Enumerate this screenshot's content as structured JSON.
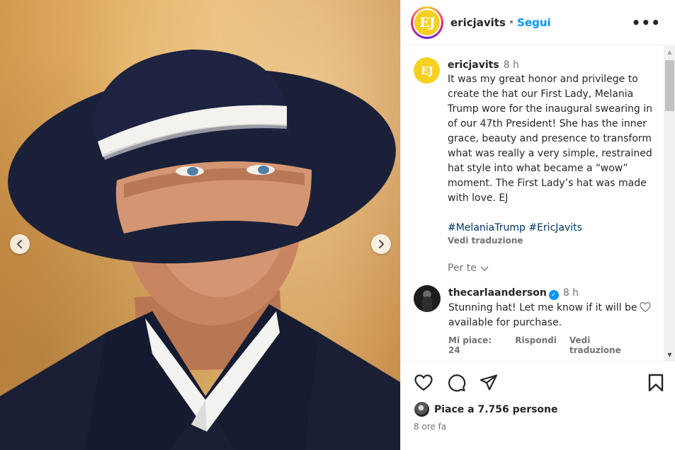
{
  "header": {
    "avatar_initials": "EJ",
    "username": "ericjavits",
    "separator": "•",
    "follow_label": "Segui",
    "more_label": "•••"
  },
  "caption": {
    "avatar_initials": "EJ",
    "username": "ericjavits",
    "time": "8 h",
    "text": "It was my great honor and privilege to create the hat our First Lady, Melania Trump wore for the inaugural swearing in of our 47th President! She has the inner grace, beauty and presence to transform what was really a very simple, restrained hat style into what became a “wow” moment. The First Lady’s hat was made with love. EJ",
    "hashtags": [
      "#MelaniaTrump",
      "#EricJavits"
    ],
    "translate_label": "Vedi traduzione",
    "for_you_label": "Per te"
  },
  "comment": {
    "username": "thecarlaanderson",
    "verified_mark": "✓",
    "time": "8 h",
    "text": "Stunning hat! Let me know if it will be available for purchase.",
    "likes_label": "Mi piace: 24",
    "reply_label": "Rispondi",
    "translate_label": "Vedi traduzione"
  },
  "footer": {
    "likes_prefix": "Piace a ",
    "likes_count": "7.756",
    "likes_suffix": " persone",
    "time_ago": "8 ore fa"
  },
  "icons": {
    "like": "heart-icon",
    "comment": "comment-icon",
    "share": "paper-plane-icon",
    "save": "bookmark-icon",
    "prev": "chevron-left-icon",
    "next": "chevron-right-icon"
  },
  "colors": {
    "link_blue": "#0095f6",
    "hashtag_blue": "#00376b",
    "secondary_text": "#737373",
    "avatar_yellow": "#f5d020"
  }
}
